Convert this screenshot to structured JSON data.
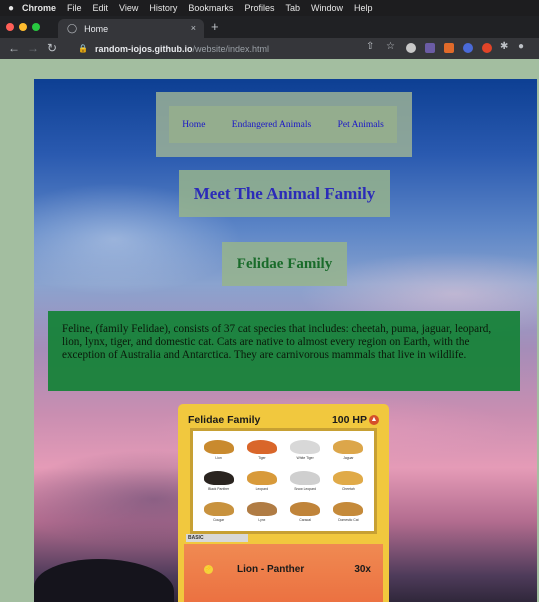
{
  "menubar": {
    "apple": "",
    "items": [
      "Chrome",
      "File",
      "Edit",
      "View",
      "History",
      "Bookmarks",
      "Profiles",
      "Tab",
      "Window",
      "Help"
    ]
  },
  "browser": {
    "tab_title": "Home",
    "tab_close": "×",
    "new_tab": "+",
    "url_host": "random-iojos.github.io",
    "url_path": "/website/index.html",
    "traffic_colors": [
      "#ff5f57",
      "#febc2e",
      "#28c840"
    ]
  },
  "nav": {
    "links": [
      "Home",
      "Endangered Animals",
      "Pet Animals"
    ]
  },
  "page": {
    "title": "Meet The Animal Family",
    "subtitle": "Felidae Family",
    "description": "Feline, (family Felidae), consists of 37 cat species that includes: cheetah, puma, jaguar, leopard, lion, lynx, tiger, and domestic cat. Cats are native to almost every region on Earth, with the exception of Australia and Antarctica. They are carnivorous mammals that live in wildlife."
  },
  "card": {
    "name": "Felidae Family",
    "hp": "100 HP",
    "stage": "BASIC",
    "attack_name": "Lion - Panther",
    "attack_damage": "30x",
    "cats": [
      {
        "label": "Lion",
        "color": "#c98a2e"
      },
      {
        "label": "Tiger",
        "color": "#d9662a"
      },
      {
        "label": "White Tiger",
        "color": "#d8d8d8"
      },
      {
        "label": "Jaguar",
        "color": "#dca64a"
      },
      {
        "label": "Black Panther",
        "color": "#2a2420"
      },
      {
        "label": "Leopard",
        "color": "#d89a3a"
      },
      {
        "label": "Snow Leopard",
        "color": "#cfcfcf"
      },
      {
        "label": "Cheetah",
        "color": "#e0aa48"
      },
      {
        "label": "Cougar",
        "color": "#c8923e"
      },
      {
        "label": "Lynx",
        "color": "#b07c44"
      },
      {
        "label": "Caracal",
        "color": "#c0843a"
      },
      {
        "label": "Domestic Cat",
        "color": "#c58a3a"
      }
    ]
  }
}
